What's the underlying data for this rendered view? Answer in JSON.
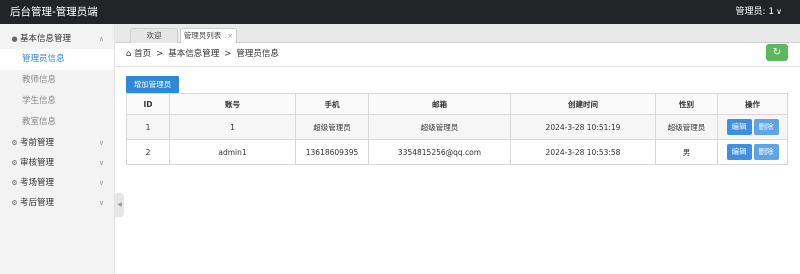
{
  "header": {
    "title": "后台管理-管理员端",
    "user_label": "管理员: 1",
    "caret": "∨"
  },
  "sidebar": {
    "groups": [
      {
        "label": "基本信息管理",
        "icon": "user-icon",
        "chevron": "∧",
        "items": [
          {
            "label": "管理员信息",
            "active": true
          },
          {
            "label": "教师信息"
          },
          {
            "label": "学生信息"
          },
          {
            "label": "教室信息"
          }
        ]
      },
      {
        "label": "考前管理",
        "icon": "gear-icon",
        "chevron": "∨"
      },
      {
        "label": "审核管理",
        "icon": "gear-icon",
        "chevron": "∨"
      },
      {
        "label": "考场管理",
        "icon": "gear-icon",
        "chevron": "∨"
      },
      {
        "label": "考后管理",
        "icon": "gear-icon",
        "chevron": "∨"
      }
    ],
    "collapse_glyph": "◀"
  },
  "tabs": [
    {
      "label": "欢迎"
    },
    {
      "label": "管理员列表",
      "close": "×",
      "active": true
    }
  ],
  "breadcrumb": {
    "home_icon": "⌂",
    "home": "首页",
    "sep": ">",
    "level1": "基本信息管理",
    "level2": "管理员信息"
  },
  "toolbar": {
    "refresh_glyph": "↻",
    "add_label": "增加管理员"
  },
  "table": {
    "headers": [
      "ID",
      "账号",
      "手机",
      "邮箱",
      "创建时间",
      "性别",
      "操作"
    ],
    "rows": [
      [
        "1",
        "1",
        "超级管理员",
        "超级管理员",
        "2024-3-28 10:51:19",
        "超级管理员"
      ],
      [
        "2",
        "admin1",
        "13618609395",
        "3354815256@qq.com",
        "2024-3-28 10:53:58",
        "男"
      ]
    ],
    "edit_label": "编辑",
    "delete_label": "删除"
  },
  "colors": {
    "topbar": "#222427",
    "accent": "#2f88d8",
    "refresh": "#5cb85c",
    "sidebar_bg": "#f3f3f3"
  }
}
